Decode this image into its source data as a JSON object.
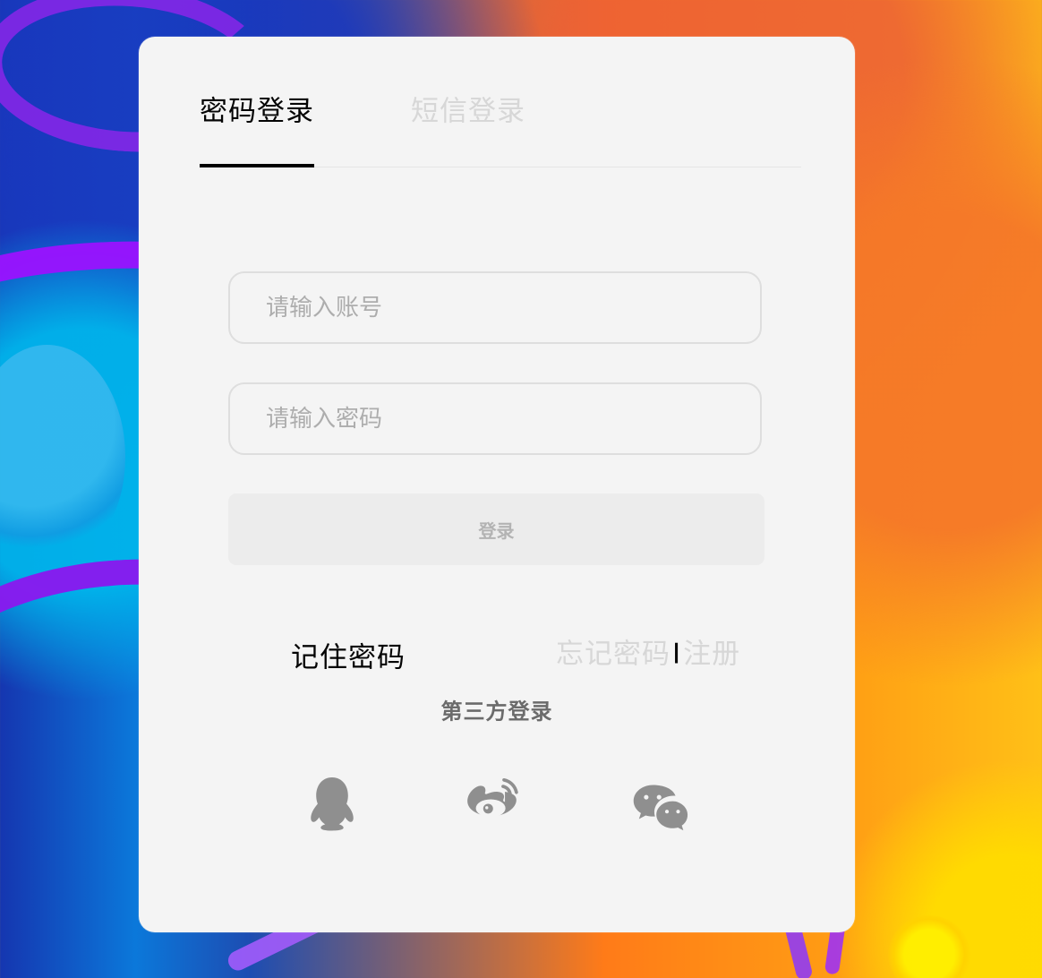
{
  "tabs": [
    {
      "label": "密码登录",
      "active": true
    },
    {
      "label": "短信登录",
      "active": false
    }
  ],
  "account_input": {
    "placeholder": "请输入账号",
    "value": ""
  },
  "password_input": {
    "placeholder": "请输入密码",
    "value": ""
  },
  "login_button": {
    "label": "登录"
  },
  "links": {
    "remember_password": "记住密码",
    "forgot_password": "忘记密码",
    "separator": "I",
    "register": "注册"
  },
  "third_party": {
    "title": "第三方登录",
    "icons": [
      "qq-icon",
      "weibo-icon",
      "wechat-icon"
    ]
  },
  "colors": {
    "card_background": "#f4f4f4",
    "active_text": "#050505",
    "inactive_text": "#d7d7d7",
    "input_border": "#dedede",
    "button_background": "#ececec",
    "icon_gray": "#8f8f8f"
  }
}
